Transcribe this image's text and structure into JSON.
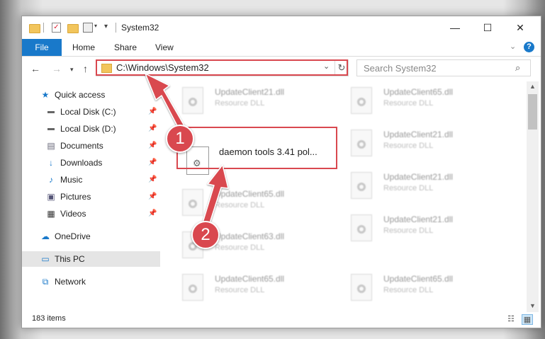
{
  "window": {
    "title": "System32",
    "controls": {
      "minimize": "—",
      "maximize": "☐",
      "close": "✕"
    }
  },
  "ribbon": {
    "file": "File",
    "tabs": [
      "Home",
      "Share",
      "View"
    ],
    "help": "?"
  },
  "address": {
    "path": "C:\\Windows\\System32"
  },
  "search": {
    "placeholder": "Search System32"
  },
  "navpane": {
    "items": [
      {
        "label": "Quick access",
        "icon": "star-icon",
        "pinned": false
      },
      {
        "label": "Local Disk (C:)",
        "icon": "drive-icon",
        "pinned": true
      },
      {
        "label": "Local Disk (D:)",
        "icon": "drive-icon",
        "pinned": true
      },
      {
        "label": "Documents",
        "icon": "documents-icon",
        "pinned": true
      },
      {
        "label": "Downloads",
        "icon": "download-icon",
        "pinned": true
      },
      {
        "label": "Music",
        "icon": "music-icon",
        "pinned": true
      },
      {
        "label": "Pictures",
        "icon": "pictures-icon",
        "pinned": true
      },
      {
        "label": "Videos",
        "icon": "videos-icon",
        "pinned": true
      },
      {
        "label": "OneDrive",
        "icon": "cloud-icon",
        "pinned": false
      },
      {
        "label": "This PC",
        "icon": "computer-icon",
        "pinned": false,
        "selected": true
      },
      {
        "label": "Network",
        "icon": "network-icon",
        "pinned": false
      }
    ]
  },
  "files": {
    "col1": [
      {
        "name": "UpdateClient21.dll",
        "type": "Resource DLL"
      },
      {
        "name": "UpdateClient65.dll",
        "type": "Resource DLL"
      },
      {
        "name": "UpdateClient63.dll",
        "type": "Resource DLL"
      },
      {
        "name": "UpdateClient65.dll",
        "type": "Resource DLL"
      }
    ],
    "col2": [
      {
        "name": "UpdateClient65.dll",
        "type": "Resource DLL"
      },
      {
        "name": "UpdateClient21.dll",
        "type": "Resource DLL"
      },
      {
        "name": "UpdateClient21.dll",
        "type": "Resource DLL"
      },
      {
        "name": "UpdateClient21.dll",
        "type": "Resource DLL"
      },
      {
        "name": "UpdateClient65.dll",
        "type": "Resource DLL"
      }
    ],
    "highlighted": {
      "name": "daemon tools 3.41 pol..."
    }
  },
  "status": {
    "item_count": "183 items"
  },
  "annotations": {
    "step1": "1",
    "step2": "2",
    "color": "#d9484f"
  }
}
